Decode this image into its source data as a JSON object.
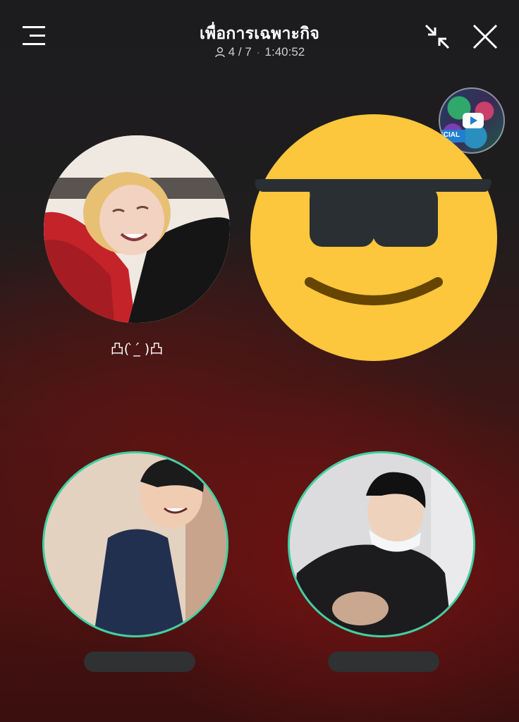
{
  "header": {
    "title": "เพื่อการเฉพาะกิจ",
    "participants": "4 / 7",
    "separator": "·",
    "duration": "1:40:52",
    "icons": {
      "menu": "menu-icon",
      "person": "person-icon",
      "minimize": "minimize-icon",
      "close": "close-icon"
    }
  },
  "media": {
    "thumbnail_band_text": "ICIAL",
    "icon": "youtube-play-icon"
  },
  "participants": [
    {
      "display_name": "凸( ̀_́ )凸",
      "avatar": "photo"
    },
    {
      "display_name": "",
      "avatar": "smiling-face-with-sunglasses-emoji"
    },
    {
      "display_name": "",
      "avatar": "photo",
      "speaking": true
    },
    {
      "display_name": "",
      "avatar": "photo",
      "speaking": true
    }
  ],
  "colors": {
    "speaking_ring": "#3fd0a0",
    "emoji_face": "#fcc63d",
    "name_pill": "#2f3133"
  }
}
